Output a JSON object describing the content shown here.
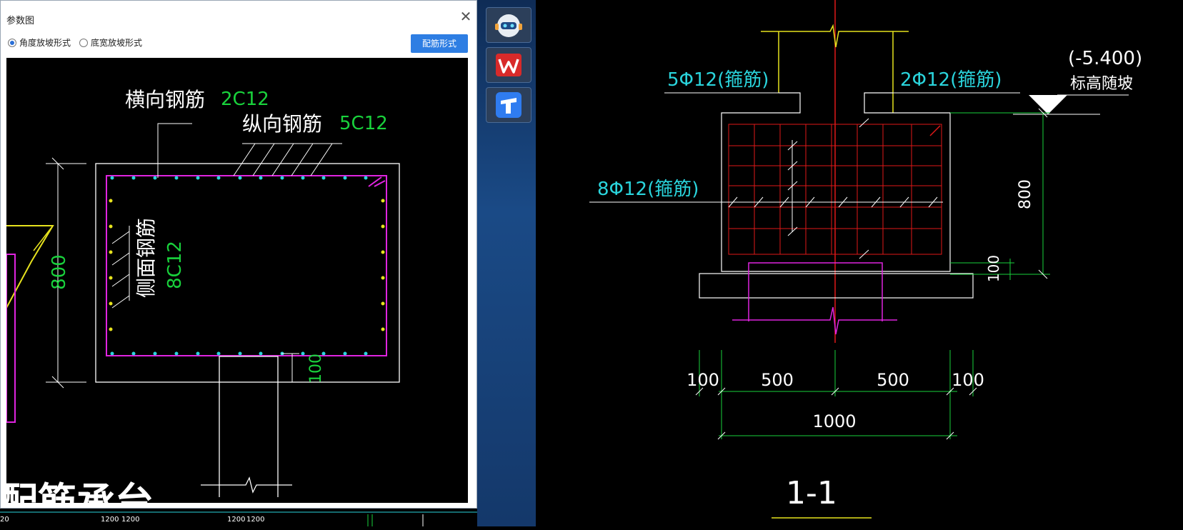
{
  "dialog": {
    "title": "参数图",
    "close_glyph": "✕",
    "radio_options": [
      {
        "label": "角度放坡形式",
        "checked": true
      },
      {
        "label": "底宽放坡形式",
        "checked": false
      }
    ],
    "rebar_button": "配筋形式"
  },
  "preview": {
    "transverse_label": "横向钢筋",
    "transverse_value": "2C12",
    "longitudinal_label": "纵向钢筋",
    "longitudinal_value": "5C12",
    "side_label": "侧面钢筋",
    "side_value": "8C12",
    "dim_height": "800",
    "dim_bottom": "100",
    "bg_title": "配筋承台",
    "scale_marks": [
      "20",
      "1200",
      "1200",
      "1200",
      "1200"
    ]
  },
  "section": {
    "rebar_top_left": "5Φ12(箍筋)",
    "rebar_top_right": "2Φ12(箍筋)",
    "rebar_left": "8Φ12(箍筋)",
    "elevation": "(-5.400)",
    "elevation_note": "标高随坡",
    "dim_800": "800",
    "dim_100_right": "100",
    "dims_bottom": [
      "100",
      "500",
      "500",
      "100"
    ],
    "dim_total": "1000",
    "section_label": "1-1"
  },
  "colors": {
    "cyan": "#2ad4dc",
    "green": "#19d23c",
    "magenta": "#e024e0",
    "red": "#e01818",
    "yellow": "#e6e21e",
    "white": "#ffffff"
  },
  "taskbar": {
    "icons": [
      "robot-icon",
      "wps-icon",
      "tencent-docs-icon"
    ]
  }
}
